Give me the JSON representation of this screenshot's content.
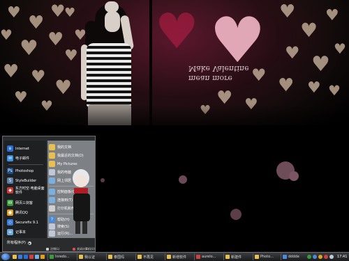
{
  "start_menu": {
    "pinned": [
      {
        "label": "Internet",
        "icon": "ie-icon",
        "color": "#2a6fd6"
      },
      {
        "label": "电子邮件",
        "icon": "mail-icon",
        "color": "#3b8fe0"
      }
    ],
    "recent": [
      {
        "label": "Photoshop",
        "icon": "photoshop-icon",
        "color": "#1d4f8f"
      },
      {
        "label": "StyleBuilder",
        "icon": "stylebuilder-icon",
        "color": "#5a7fa8"
      },
      {
        "label": "东方时空·电脑桌面软件",
        "icon": "desktop-software-icon",
        "color": "#cc3a3a"
      },
      {
        "label": "网页三剑客",
        "icon": "web-suite-icon",
        "color": "#3a9a3a"
      },
      {
        "label": "腾讯QQ",
        "icon": "qq-icon",
        "color": "#e0a020"
      },
      {
        "label": "Securefix 9.1",
        "icon": "securefix-icon",
        "color": "#3a7ad8"
      },
      {
        "label": "记事本",
        "icon": "notepad-icon",
        "color": "#6aa6d8"
      }
    ],
    "all_programs_label": "所有程序(P)",
    "places": [
      {
        "label": "我的文档",
        "icon": "my-documents-icon",
        "color": "#e8c050"
      },
      {
        "label": "我最近的文档(D)",
        "icon": "recent-docs-icon",
        "color": "#e8c050"
      },
      {
        "label": "My Pictures",
        "icon": "my-pictures-icon",
        "color": "#e8c050"
      },
      {
        "label": "我的电脑",
        "icon": "my-computer-icon",
        "color": "#c0c8d8"
      },
      {
        "label": "网上邻居",
        "icon": "network-icon",
        "color": "#7ab0e0"
      },
      {
        "label": "控制面板(C)",
        "icon": "control-panel-icon",
        "color": "#7ab0e0"
      },
      {
        "label": "连接到(T)",
        "icon": "connect-icon",
        "color": "#7ab0e0"
      },
      {
        "label": "打印机和传真",
        "icon": "printer-icon",
        "color": "#cfcfcf"
      },
      {
        "label": "帮助(H)",
        "icon": "help-icon",
        "color": "#4a8ad8"
      },
      {
        "label": "搜索(S)",
        "icon": "search-icon",
        "color": "#c0c8d8"
      },
      {
        "label": "运行(R)...",
        "icon": "run-icon",
        "color": "#c0c8d8"
      }
    ],
    "logoff_label": "注销(L)",
    "shutdown_label": "关闭计算机(U)"
  },
  "wallpaper": {
    "text_line_1": "Make Valentine",
    "text_line_2": "mean more"
  },
  "taskbar": {
    "items": [
      {
        "label": "Inredo...",
        "icon": "window-icon",
        "color": "#3a9a3a"
      },
      {
        "label": "我以证",
        "icon": "folder-icon",
        "color": "#e8c050"
      },
      {
        "label": "泰国玛",
        "icon": "folder-icon",
        "color": "#e8c050"
      },
      {
        "label": "不再见",
        "icon": "folder-icon",
        "color": "#e8c050"
      },
      {
        "label": "新增软件",
        "icon": "folder-icon",
        "color": "#e8c050"
      },
      {
        "label": "aurelo...",
        "icon": "app-icon",
        "color": "#d04040"
      },
      {
        "label": "新建件",
        "icon": "folder-icon",
        "color": "#e8c050"
      },
      {
        "label": "Photo...",
        "icon": "folder-icon",
        "color": "#e8c050"
      },
      {
        "label": "dddde",
        "icon": "app-icon",
        "color": "#4a8ad8"
      }
    ],
    "clock": "17:41"
  }
}
